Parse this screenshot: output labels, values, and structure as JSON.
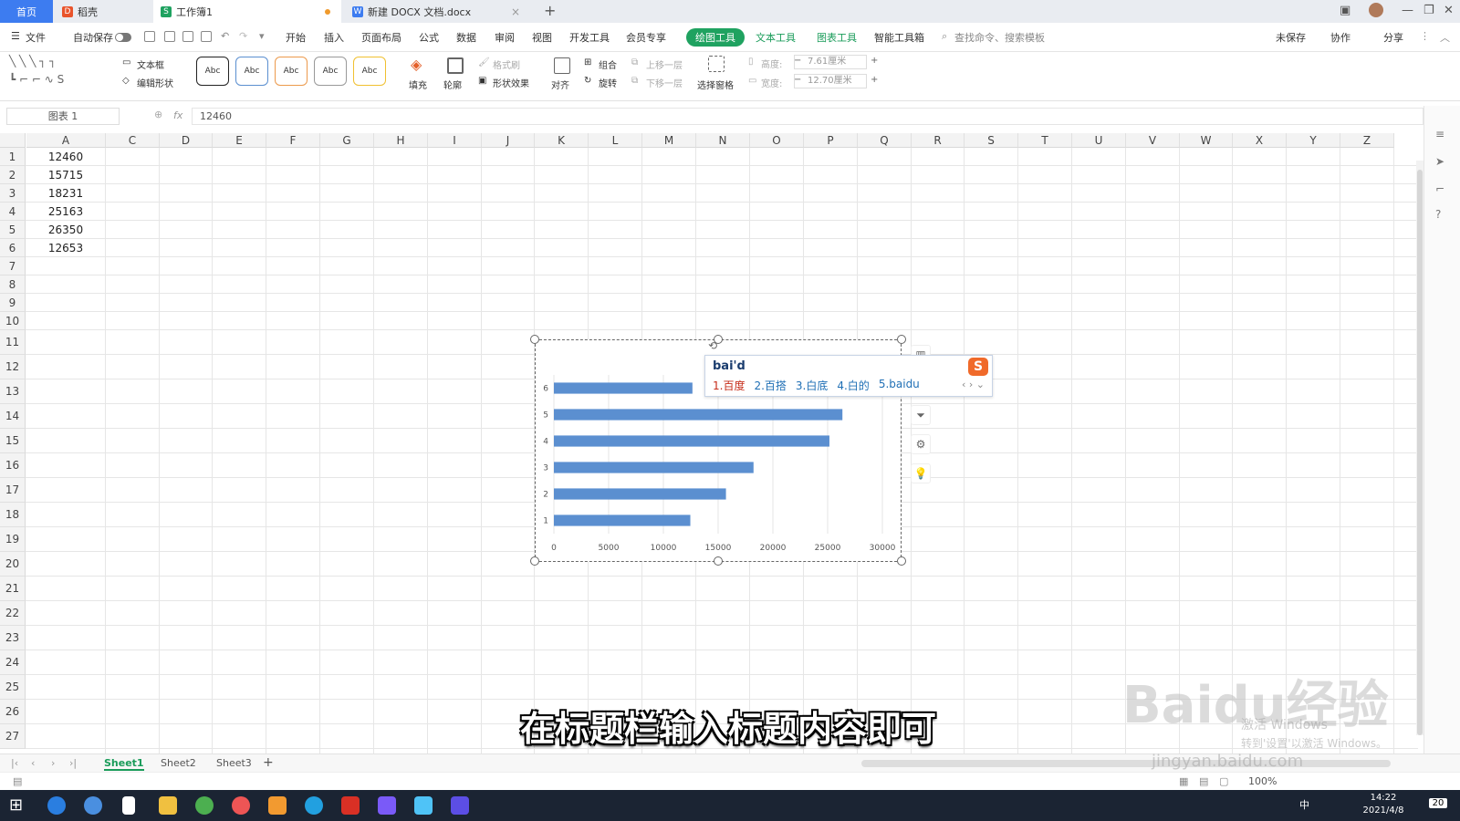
{
  "tabs": {
    "home": "首页",
    "daoke": "稻壳",
    "workbook": "工作簿1",
    "docx": "新建 DOCX 文档.docx"
  },
  "menu": {
    "file": "文件",
    "autosave": "自动保存",
    "items": [
      "开始",
      "插入",
      "页面布局",
      "公式",
      "数据",
      "审阅",
      "视图",
      "开发工具",
      "会员专享"
    ],
    "active_tab": "绘图工具",
    "context_tabs": [
      "文本工具",
      "图表工具",
      "智能工具箱"
    ],
    "search": "查找命令、搜索模板",
    "unsaved": "未保存",
    "collab": "协作",
    "share": "分享"
  },
  "ribbon": {
    "textbox": "文本框",
    "edit_shape": "编辑形状",
    "style_sample": "Abc",
    "fill": "填充",
    "outline": "轮廓",
    "format_painter": "格式刷",
    "shape_effect": "形状效果",
    "align": "对齐",
    "group": "组合",
    "rotate": "旋转",
    "bring_forward": "上移一层",
    "send_backward": "下移一层",
    "select_pane": "选择窗格",
    "height_label": "高度:",
    "height_value": "7.61厘米",
    "width_label": "宽度:",
    "width_value": "12.70厘米"
  },
  "formula_bar": {
    "name_box": "图表 1",
    "fx": "fx",
    "formula": "12460"
  },
  "columns": [
    "A",
    "C",
    "D",
    "E",
    "F",
    "G",
    "H",
    "I",
    "J",
    "K",
    "L",
    "M",
    "N",
    "O",
    "P",
    "Q",
    "R",
    "S",
    "T",
    "U",
    "V",
    "W",
    "X",
    "Y",
    "Z"
  ],
  "rows": [
    "1",
    "2",
    "3",
    "4",
    "5",
    "6",
    "7",
    "8",
    "9",
    "10",
    "11",
    "12",
    "13",
    "14",
    "15",
    "16",
    "17",
    "18",
    "19",
    "20",
    "21",
    "22",
    "23",
    "24",
    "25",
    "26",
    "27"
  ],
  "cells_a": [
    "12460",
    "15715",
    "18231",
    "25163",
    "26350",
    "12653"
  ],
  "chart_data": {
    "type": "bar",
    "orientation": "horizontal",
    "categories": [
      "1",
      "2",
      "3",
      "4",
      "5",
      "6"
    ],
    "values": [
      12460,
      15715,
      18231,
      25163,
      26350,
      12653
    ],
    "xlim": [
      0,
      30000
    ],
    "x_ticks": [
      "0",
      "5000",
      "10000",
      "15000",
      "20000",
      "25000",
      "30000"
    ],
    "bar_color": "#5b8fd0",
    "title": "",
    "grid": true
  },
  "ime": {
    "input": "bai'd",
    "candidates": [
      "1.百度",
      "2.百搭",
      "3.白底",
      "4.白的",
      "5.baidu"
    ]
  },
  "sheets": [
    "Sheet1",
    "Sheet2",
    "Sheet3"
  ],
  "status": {
    "zoom": "100%"
  },
  "taskbar": {
    "time": "14:22",
    "date": "2021/4/8",
    "notify": "20",
    "ime_mode": "中"
  },
  "subtitle": "在标题栏输入标题内容即可",
  "watermark": {
    "brand": "Baidu经验",
    "url": "jingyan.baidu.com",
    "activate": "激活 Windows",
    "activate_sub": "转到'设置'以激活 Windows。"
  },
  "colors": {
    "accent_green": "#1fa260",
    "home_tab": "#3d7cf0",
    "bar": "#5b8fd0"
  }
}
